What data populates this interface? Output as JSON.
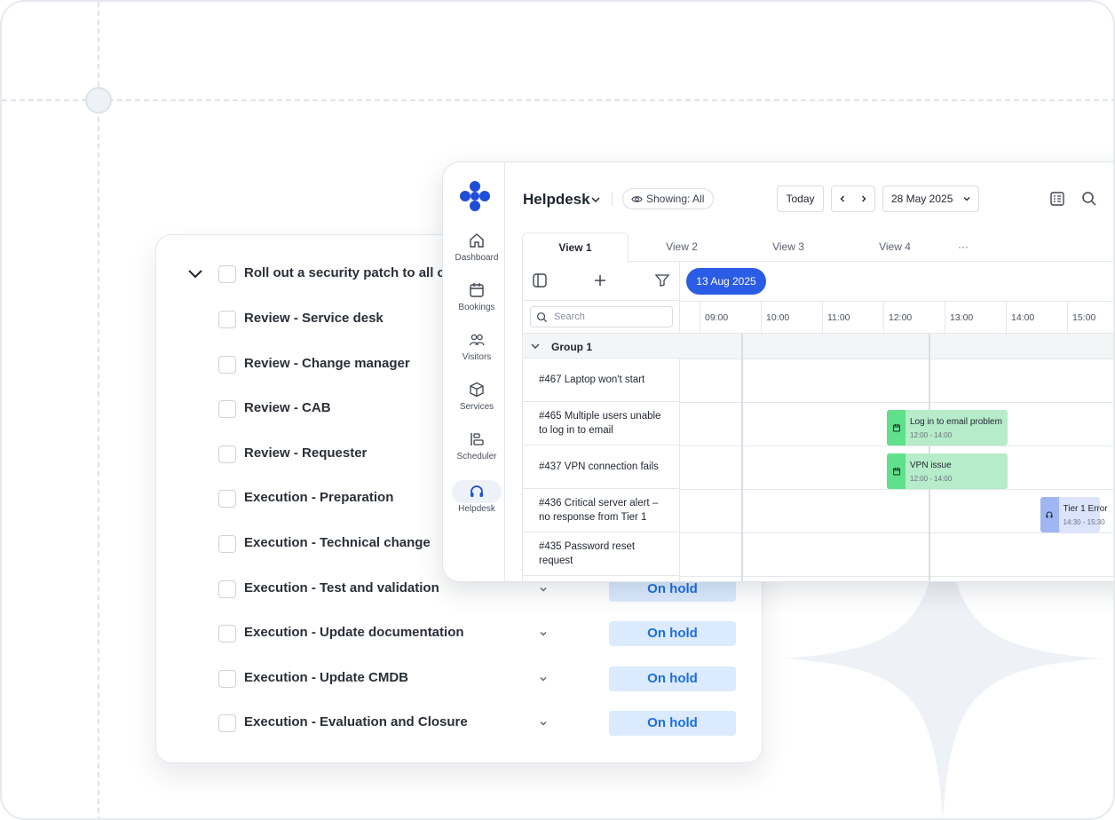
{
  "tasks": {
    "parent": {
      "label": "Roll out a security patch to all co"
    },
    "items": [
      {
        "label": "Review - Service desk",
        "status": ""
      },
      {
        "label": "Review - Change manager",
        "status": ""
      },
      {
        "label": "Review - CAB",
        "status": ""
      },
      {
        "label": "Review - Requester",
        "status": ""
      },
      {
        "label": "Execution - Preparation",
        "status": ""
      },
      {
        "label": "Execution - Technical change",
        "status": ""
      },
      {
        "label": "Execution - Test and validation",
        "status": "On hold"
      },
      {
        "label": "Execution - Update documentation",
        "status": "On hold"
      },
      {
        "label": "Execution - Update CMDB",
        "status": "On hold"
      },
      {
        "label": "Execution - Evaluation and Closure",
        "status": "On hold"
      }
    ]
  },
  "nav": {
    "items": [
      {
        "label": "Dashboard",
        "icon": "home-icon"
      },
      {
        "label": "Bookings",
        "icon": "calendar-icon"
      },
      {
        "label": "Visitors",
        "icon": "users-icon"
      },
      {
        "label": "Services",
        "icon": "box-icon"
      },
      {
        "label": "Scheduler",
        "icon": "scheduler-icon"
      },
      {
        "label": "Helpdesk",
        "icon": "headset-icon",
        "active": true
      }
    ]
  },
  "header": {
    "title": "Helpdesk",
    "showing": "Showing: All",
    "today": "Today",
    "date": "28 May 2025"
  },
  "tabs": [
    "View 1",
    "View 2",
    "View 3",
    "View 4",
    "···"
  ],
  "grid": {
    "search_placeholder": "Search",
    "date_chip": "13 Aug 2025",
    "hours": [
      "09:00",
      "10:00",
      "11:00",
      "12:00",
      "13:00",
      "14:00",
      "15:00"
    ],
    "group": "Group 1",
    "tickets": [
      "#467 Laptop won't start",
      "#465 Multiple users unable to log in to email",
      "#437 VPN connection fails",
      "#436 Critical server alert – no response from Tier 1",
      "#435 Password reset request"
    ],
    "events": [
      {
        "title": "Log in to email problem",
        "time": "12:00 - 14:00",
        "row": 1
      },
      {
        "title": "VPN issue",
        "time": "12:00 - 14:00",
        "row": 2
      },
      {
        "title": "Tier 1 Error",
        "time": "14:30 - 15:30",
        "row": 3
      }
    ]
  },
  "colors": {
    "accent": "#2b5ce6",
    "status_bg": "#dbeafe",
    "status_text": "#1d6fdc",
    "event_green": "#b6ecc9",
    "event_blue": "#dbe4fb"
  }
}
